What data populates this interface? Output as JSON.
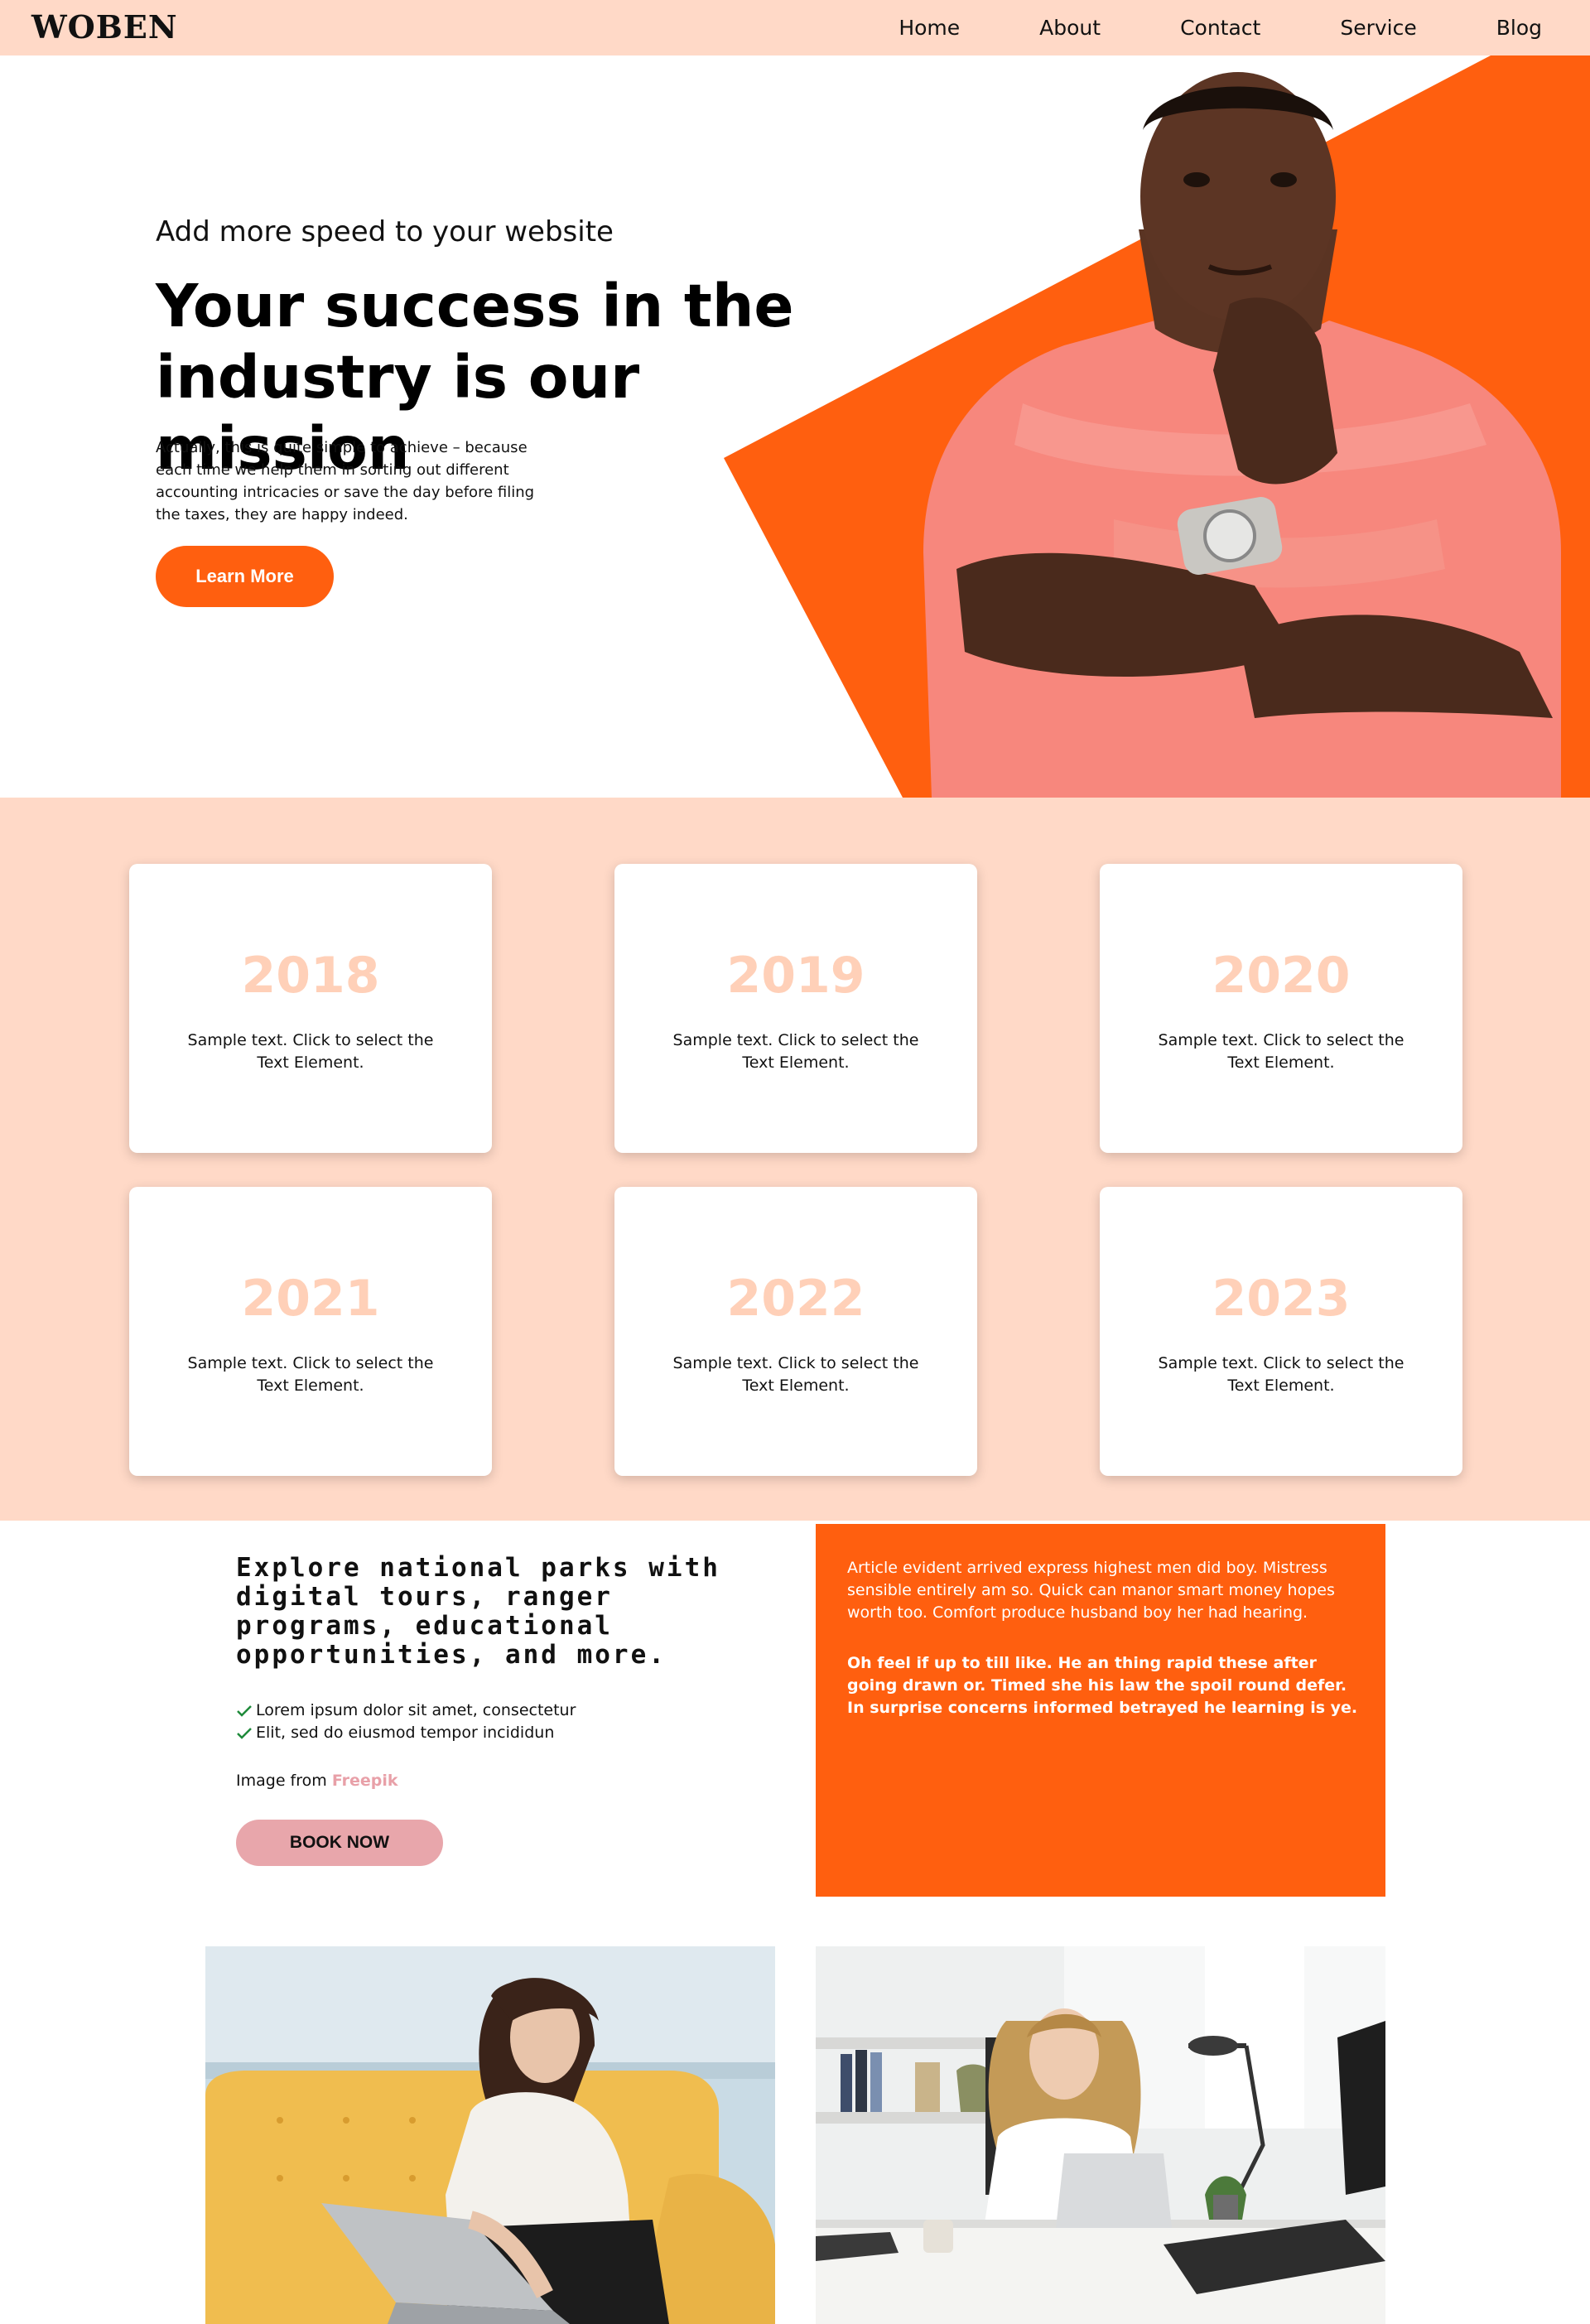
{
  "nav": {
    "logo": "WOBEN",
    "items": [
      {
        "label": "Home"
      },
      {
        "label": "About"
      },
      {
        "label": "Contact"
      },
      {
        "label": "Service"
      },
      {
        "label": "Blog"
      }
    ]
  },
  "hero": {
    "kicker": "Add more speed to your website",
    "title": "Your success in the industry is our mission",
    "text": "Actually, this is quite simple to achieve – because each time we help them in sorting out different accounting intricacies or save the day before filing the taxes, they are happy indeed.",
    "button": "Learn More",
    "accent": "#ff5f0f"
  },
  "years": {
    "cards": [
      {
        "year": "2018",
        "text": "Sample text. Click to select the Text Element."
      },
      {
        "year": "2019",
        "text": "Sample text. Click to select the Text Element."
      },
      {
        "year": "2020",
        "text": "Sample text. Click to select the Text Element."
      },
      {
        "year": "2021",
        "text": "Sample text. Click to select the Text Element."
      },
      {
        "year": "2022",
        "text": "Sample text. Click to select the Text Element."
      },
      {
        "year": "2023",
        "text": "Sample text. Click to select the Text Element."
      }
    ]
  },
  "explore": {
    "title": "Explore national parks with digital tours, ranger programs, educational opportunities, and more.",
    "checks": [
      "Lorem ipsum dolor sit amet, consectetur",
      "Elit, sed do eiusmod tempor incididun"
    ],
    "credit_prefix": "Image from",
    "credit_link": "Freepik",
    "button": "BOOK NOW"
  },
  "article": {
    "p1": "Article evident arrived express highest men did boy. Mistress sensible entirely am so. Quick can manor smart money hopes worth too. Comfort produce husband boy her had hearing.",
    "p2": "Oh feel if up to till like. He an thing rapid these after going drawn or. Timed she his law the spoil round defer. In surprise concerns informed betrayed he learning is ye."
  },
  "colors": {
    "peach": "#ffd9c7",
    "orange": "#ff5f0f",
    "pink": "#e8a6ab"
  }
}
